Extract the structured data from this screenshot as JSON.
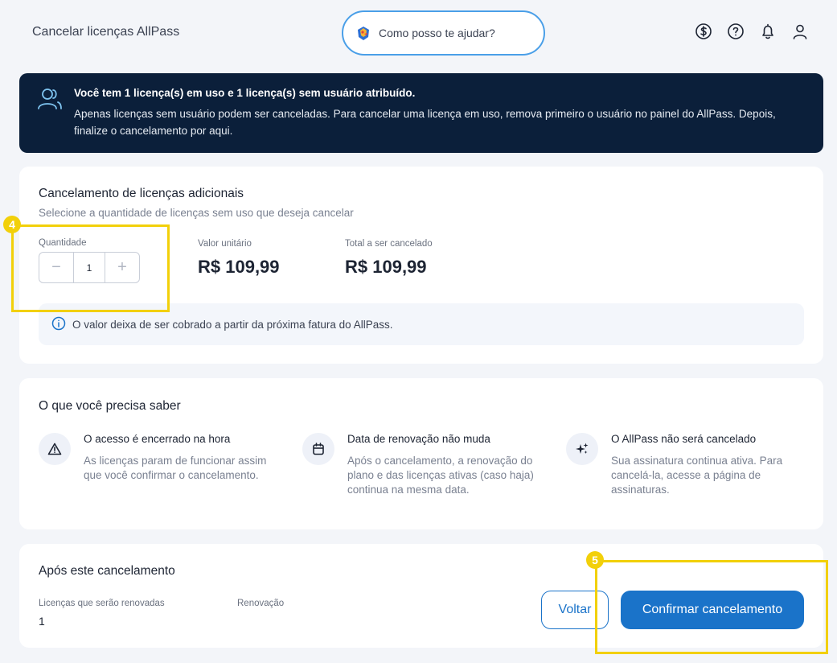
{
  "header": {
    "title": "Cancelar licenças AllPass",
    "assistant_placeholder": "Como posso te ajudar?",
    "icons": [
      "dollar-circle-icon",
      "help-circle-icon",
      "bell-icon",
      "user-icon"
    ]
  },
  "banner": {
    "title": "Você tem 1 licença(s) em uso e 1 licença(s) sem usuário atribuído.",
    "text": "Apenas licenças sem usuário podem ser canceladas. Para cancelar uma licença em uso, remova primeiro o usuário no painel do AllPass. Depois, finalize o cancelamento por aqui."
  },
  "cancel_card": {
    "title": "Cancelamento de licenças adicionais",
    "subtitle": "Selecione a quantidade de licenças sem uso que deseja cancelar",
    "quantity_label": "Quantidade",
    "quantity_value": "1",
    "minus_symbol": "−",
    "plus_symbol": "+",
    "unit_label": "Valor unitário",
    "unit_value": "R$ 109,99",
    "total_label": "Total a ser cancelado",
    "total_value": "R$ 109,99",
    "info": "O valor deixa de ser cobrado a partir da próxima fatura do AllPass."
  },
  "know_card": {
    "title": "O que você precisa saber",
    "items": [
      {
        "title": "O acesso é encerrado na hora",
        "text": "As licenças param de funcionar assim que você confirmar o cancelamento.",
        "icon": "warning-icon"
      },
      {
        "title": "Data de renovação não muda",
        "text": "Após o cancelamento, a renovação do plano e das licenças ativas (caso haja) continua na mesma data.",
        "icon": "calendar-icon"
      },
      {
        "title": "O AllPass não será cancelado",
        "text": "Sua assinatura continua ativa. Para cancelá-la, acesse a página de assinaturas.",
        "icon": "sparkles-icon"
      }
    ]
  },
  "after_card": {
    "title": "Após este cancelamento",
    "renewed_label": "Licenças que serão renovadas",
    "renewed_value": "1",
    "renewal_label": "Renovação",
    "back_label": "Voltar",
    "confirm_label": "Confirmar cancelamento"
  },
  "annotations": {
    "badge_4": "4",
    "badge_5": "5"
  },
  "colors": {
    "primary": "#1a73c9",
    "banner_bg": "#0b1f3a",
    "highlight": "#f2d00a"
  }
}
